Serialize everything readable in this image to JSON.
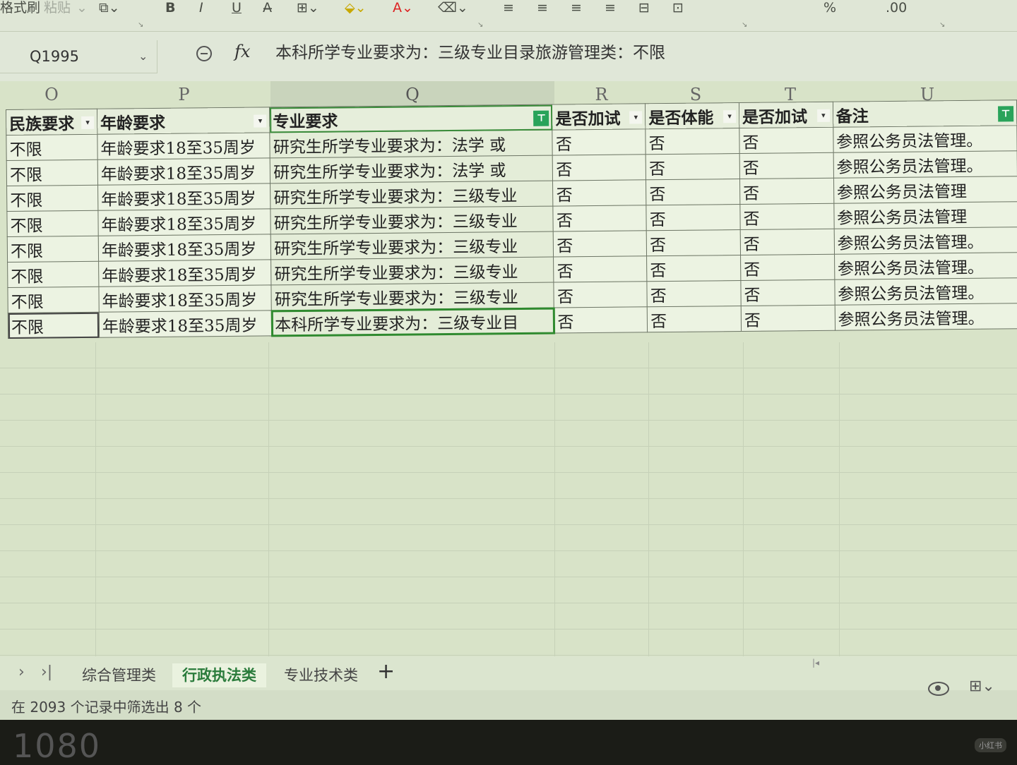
{
  "ribbon": {
    "format_painter": "格式刷",
    "paste": "粘贴",
    "bold": "B",
    "italic": "I",
    "underline": "U"
  },
  "formula_bar": {
    "name_box": "Q1995",
    "fx": "fx",
    "content": "本科所学专业要求为：三级专业目录旅游管理类：不限"
  },
  "columns": [
    "O",
    "P",
    "Q",
    "R",
    "S",
    "T",
    "U"
  ],
  "header_row": [
    "民族要求",
    "年龄要求",
    "专业要求",
    "是否加试",
    "是否体能",
    "是否加试",
    "备注"
  ],
  "rows": [
    [
      "不限",
      "年龄要求18至35周岁",
      "研究生所学专业要求为：法学 或",
      "否",
      "否",
      "否",
      "参照公务员法管理。"
    ],
    [
      "不限",
      "年龄要求18至35周岁",
      "研究生所学专业要求为：法学 或",
      "否",
      "否",
      "否",
      "参照公务员法管理。"
    ],
    [
      "不限",
      "年龄要求18至35周岁",
      "研究生所学专业要求为：三级专业",
      "否",
      "否",
      "否",
      "参照公务员法管理"
    ],
    [
      "不限",
      "年龄要求18至35周岁",
      "研究生所学专业要求为：三级专业",
      "否",
      "否",
      "否",
      "参照公务员法管理"
    ],
    [
      "不限",
      "年龄要求18至35周岁",
      "研究生所学专业要求为：三级专业",
      "否",
      "否",
      "否",
      "参照公务员法管理。"
    ],
    [
      "不限",
      "年龄要求18至35周岁",
      "研究生所学专业要求为：三级专业",
      "否",
      "否",
      "否",
      "参照公务员法管理。"
    ],
    [
      "不限",
      "年龄要求18至35周岁",
      "研究生所学专业要求为：三级专业",
      "否",
      "否",
      "否",
      "参照公务员法管理。"
    ],
    [
      "不限",
      "年龄要求18至35周岁",
      "本科所学专业要求为：三级专业目",
      "否",
      "否",
      "否",
      "参照公务员法管理。"
    ]
  ],
  "sheet_tabs": [
    "综合管理类",
    "行政执法类",
    "专业技术类"
  ],
  "active_tab": "行政执法类",
  "status": "在 2093 个记录中筛选出 8 个",
  "bottom_text": "1080",
  "watermark": "小红书",
  "colors": {
    "accent": "#2f8a2f",
    "filter": "#29a35a"
  }
}
